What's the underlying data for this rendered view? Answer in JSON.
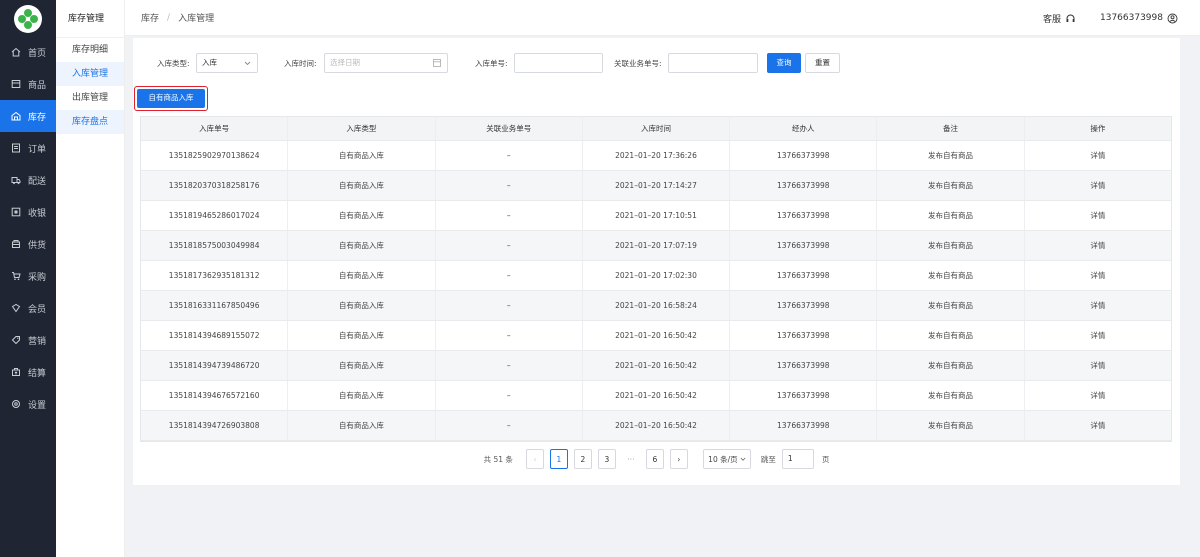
{
  "nav": {
    "items": [
      {
        "label": "首页",
        "icon": "home-icon"
      },
      {
        "label": "商品",
        "icon": "box-icon"
      },
      {
        "label": "库存",
        "icon": "warehouse-icon",
        "active": true
      },
      {
        "label": "订单",
        "icon": "order-icon"
      },
      {
        "label": "配送",
        "icon": "truck-icon"
      },
      {
        "label": "收银",
        "icon": "cashier-icon"
      },
      {
        "label": "供货",
        "icon": "supply-icon"
      },
      {
        "label": "采购",
        "icon": "cart-icon"
      },
      {
        "label": "会员",
        "icon": "member-icon"
      },
      {
        "label": "营销",
        "icon": "tag-icon"
      },
      {
        "label": "结算",
        "icon": "settle-icon"
      },
      {
        "label": "设置",
        "icon": "gear-icon"
      }
    ]
  },
  "subnav": {
    "title": "库存管理",
    "items": [
      "库存明细",
      "入库管理",
      "出库管理",
      "库存盘点"
    ]
  },
  "header": {
    "crumb_root": "库存",
    "crumb_current": "入库管理",
    "service_label": "客服",
    "user_phone": "13766373998"
  },
  "filter": {
    "type_label": "入库类型:",
    "type_value": "入库",
    "time_label": "入库时间:",
    "time_placeholder": "选择日期",
    "no_label": "入库单号:",
    "biz_label": "关联业务单号:",
    "search_label": "查询",
    "reset_label": "重置"
  },
  "own_button_label": "自有商品入库",
  "table": {
    "columns": [
      "入库单号",
      "入库类型",
      "关联业务单号",
      "入库时间",
      "经办人",
      "备注",
      "操作"
    ],
    "rows": [
      [
        "1351825902970138624",
        "自有商品入库",
        "–",
        "2021–01–20 17:36:26",
        "13766373998",
        "发布自有商品",
        "详情"
      ],
      [
        "1351820370318258176",
        "自有商品入库",
        "–",
        "2021–01–20 17:14:27",
        "13766373998",
        "发布自有商品",
        "详情"
      ],
      [
        "1351819465286017024",
        "自有商品入库",
        "–",
        "2021–01–20 17:10:51",
        "13766373998",
        "发布自有商品",
        "详情"
      ],
      [
        "1351818575003049984",
        "自有商品入库",
        "–",
        "2021–01–20 17:07:19",
        "13766373998",
        "发布自有商品",
        "详情"
      ],
      [
        "1351817362935181312",
        "自有商品入库",
        "–",
        "2021–01–20 17:02:30",
        "13766373998",
        "发布自有商品",
        "详情"
      ],
      [
        "1351816331167850496",
        "自有商品入库",
        "–",
        "2021–01–20 16:58:24",
        "13766373998",
        "发布自有商品",
        "详情"
      ],
      [
        "1351814394689155072",
        "自有商品入库",
        "–",
        "2021–01–20 16:50:42",
        "13766373998",
        "发布自有商品",
        "详情"
      ],
      [
        "1351814394739486720",
        "自有商品入库",
        "–",
        "2021–01–20 16:50:42",
        "13766373998",
        "发布自有商品",
        "详情"
      ],
      [
        "1351814394676572160",
        "自有商品入库",
        "–",
        "2021–01–20 16:50:42",
        "13766373998",
        "发布自有商品",
        "详情"
      ],
      [
        "1351814394726903808",
        "自有商品入库",
        "–",
        "2021–01–20 16:50:42",
        "13766373998",
        "发布自有商品",
        "详情"
      ]
    ]
  },
  "pager": {
    "total": "共 51 条",
    "pages": [
      "1",
      "2",
      "3"
    ],
    "ellipsis": "···",
    "last_page": "6",
    "page_size": "10 条/页",
    "jump_label": "跳至",
    "jump_value": "1",
    "page_unit": "页"
  }
}
